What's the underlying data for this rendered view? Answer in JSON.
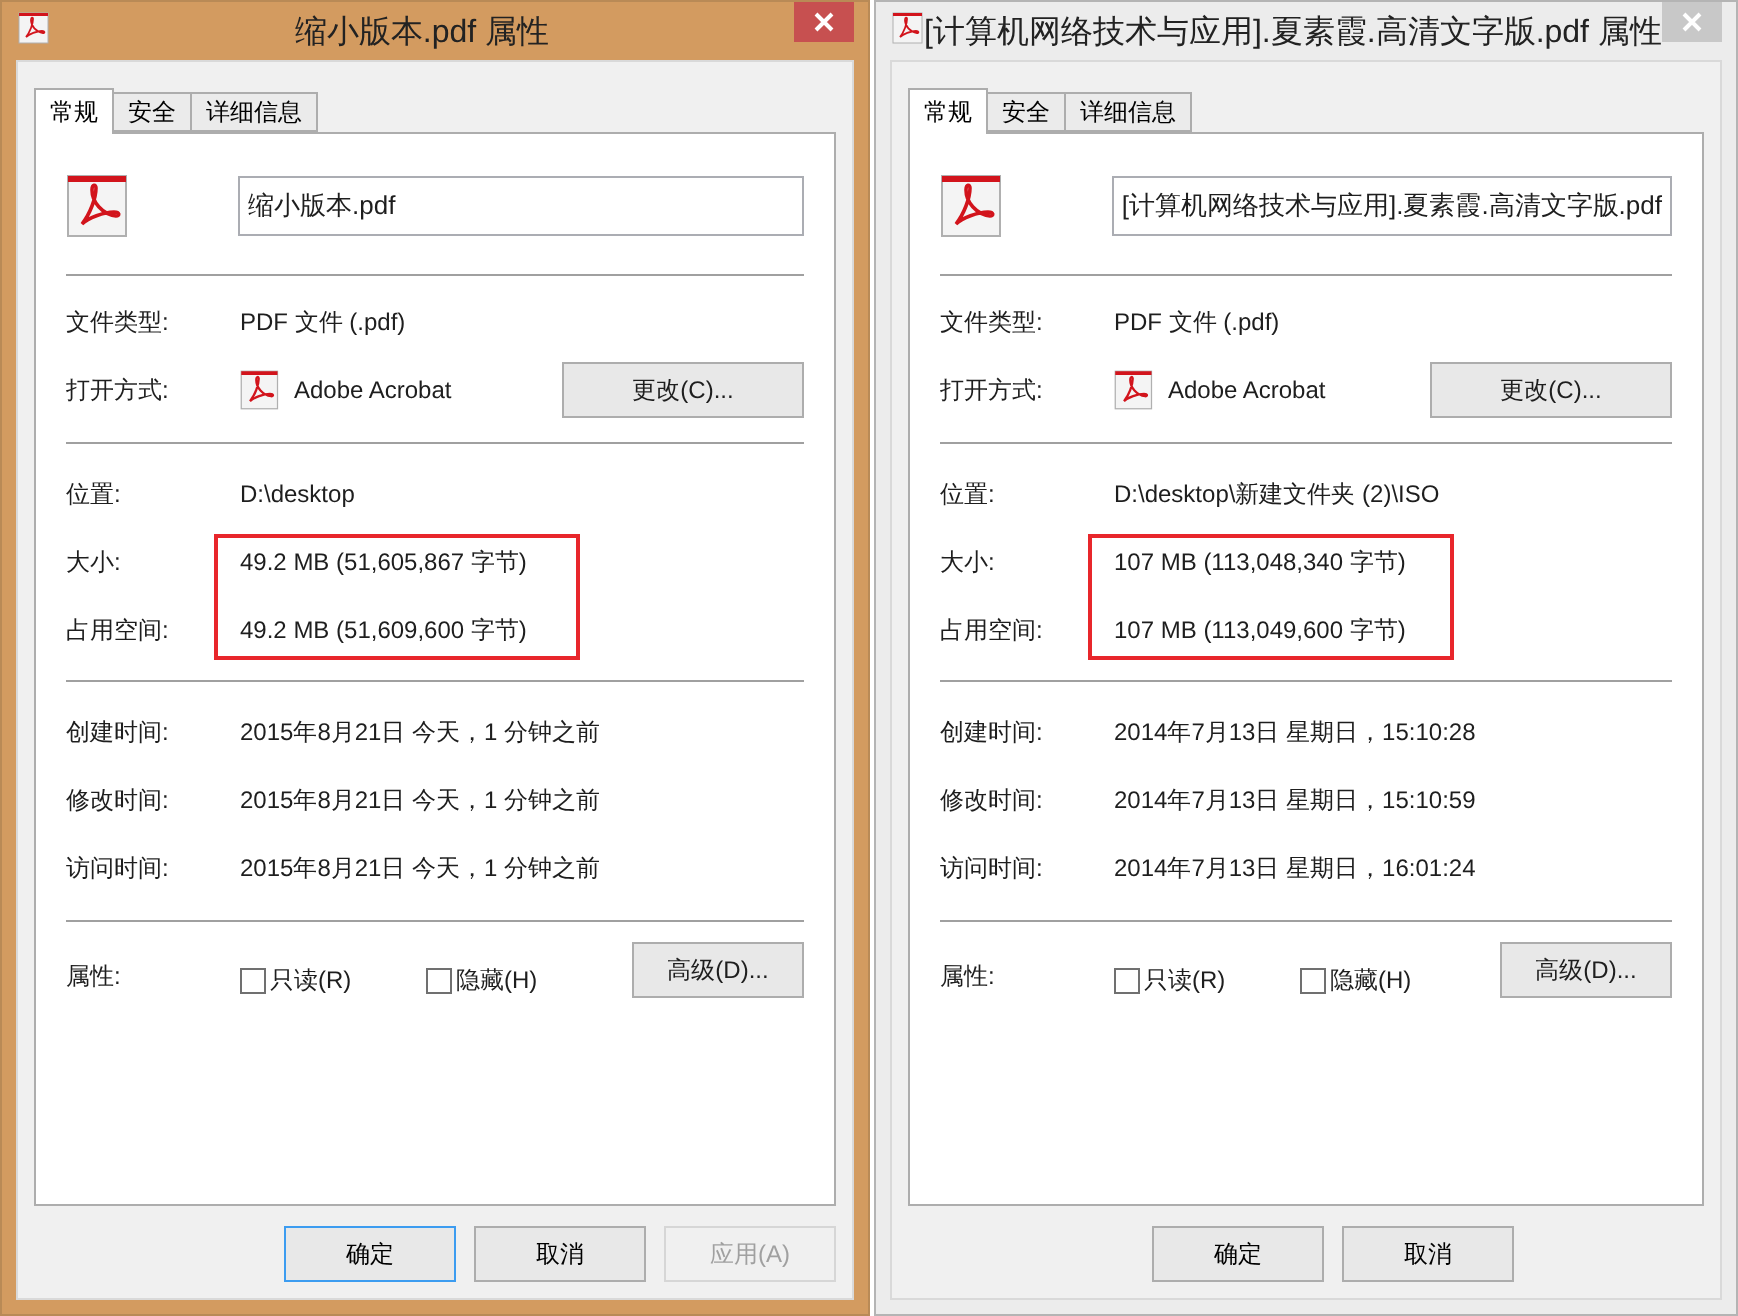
{
  "dialogs": [
    {
      "title": "缩小版本.pdf 属性",
      "active": true,
      "tabs": [
        {
          "label": "常规",
          "selected": true
        },
        {
          "label": "安全",
          "selected": false
        },
        {
          "label": "详细信息",
          "selected": false
        }
      ],
      "filename": "缩小版本.pdf",
      "type_label": "文件类型:",
      "type_value": "PDF 文件 (.pdf)",
      "open_label": "打开方式:",
      "open_app": "Adobe Acrobat",
      "change_button": "更改(C)...",
      "location_label": "位置:",
      "location_value": "D:\\desktop",
      "size_label": "大小:",
      "size_value": "49.2 MB (51,605,867 字节)",
      "disk_label": "占用空间:",
      "disk_value": "49.2 MB (51,609,600 字节)",
      "size_highlighted": true,
      "times": [
        {
          "label": "创建时间:",
          "value": "2015年8月21日 今天，1 分钟之前"
        },
        {
          "label": "修改时间:",
          "value": "2015年8月21日 今天，1 分钟之前"
        },
        {
          "label": "访问时间:",
          "value": "2015年8月21日 今天，1 分钟之前"
        }
      ],
      "attr_label": "属性:",
      "checkboxes": [
        {
          "label": "只读(R)",
          "checked": false
        },
        {
          "label": "隐藏(H)",
          "checked": false
        }
      ],
      "advanced_button": "高级(D)...",
      "buttons": [
        {
          "label": "确定",
          "kind": "default"
        },
        {
          "label": "取消",
          "kind": "normal"
        },
        {
          "label": "应用(A)",
          "kind": "disabled"
        }
      ]
    },
    {
      "title": "[计算机网络技术与应用].夏素霞.高清文字版.pdf 属性",
      "active": false,
      "tabs": [
        {
          "label": "常规",
          "selected": true
        },
        {
          "label": "安全",
          "selected": false
        },
        {
          "label": "详细信息",
          "selected": false
        }
      ],
      "filename": "[计算机网络技术与应用].夏素霞.高清文字版.pdf",
      "type_label": "文件类型:",
      "type_value": "PDF 文件 (.pdf)",
      "open_label": "打开方式:",
      "open_app": "Adobe Acrobat",
      "change_button": "更改(C)...",
      "location_label": "位置:",
      "location_value": "D:\\desktop\\新建文件夹 (2)\\ISO",
      "size_label": "大小:",
      "size_value": "107 MB (113,048,340 字节)",
      "disk_label": "占用空间:",
      "disk_value": "107 MB (113,049,600 字节)",
      "size_highlighted": true,
      "times": [
        {
          "label": "创建时间:",
          "value": "2014年7月13日 星期日，15:10:28"
        },
        {
          "label": "修改时间:",
          "value": "2014年7月13日 星期日，15:10:59"
        },
        {
          "label": "访问时间:",
          "value": "2014年7月13日 星期日，16:01:24"
        }
      ],
      "attr_label": "属性:",
      "checkboxes": [
        {
          "label": "只读(R)",
          "checked": false
        },
        {
          "label": "隐藏(H)",
          "checked": false
        }
      ],
      "advanced_button": "高级(D)...",
      "buttons": [
        {
          "label": "确定",
          "kind": "normal"
        },
        {
          "label": "取消",
          "kind": "normal"
        }
      ]
    }
  ]
}
